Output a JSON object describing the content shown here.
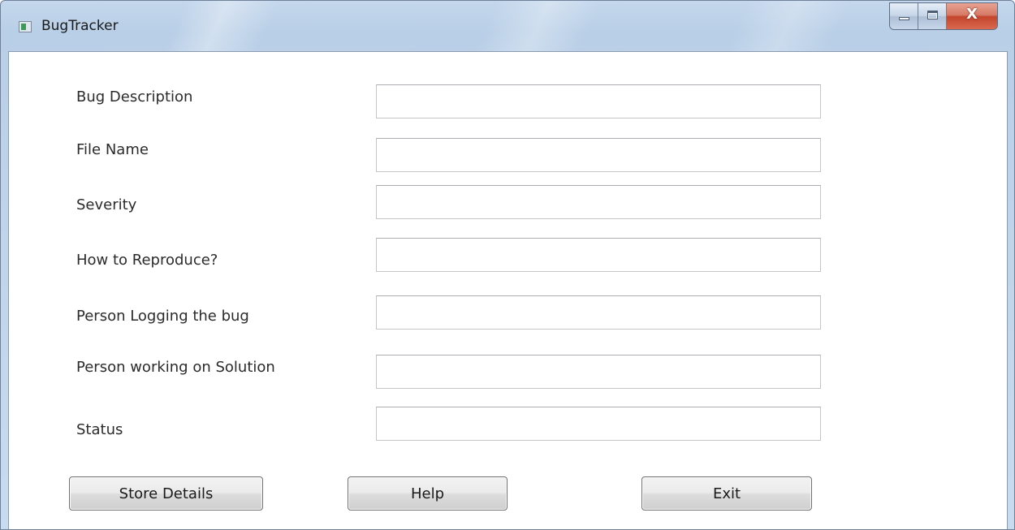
{
  "window": {
    "title": "BugTracker",
    "controls": {
      "minimize": "minimize-icon",
      "maximize": "maximize-icon",
      "close_label": "X"
    }
  },
  "form": {
    "fields": [
      {
        "label": "Bug Description",
        "value": ""
      },
      {
        "label": "File Name",
        "value": ""
      },
      {
        "label": "Severity",
        "value": ""
      },
      {
        "label": "How to Reproduce?",
        "value": ""
      },
      {
        "label": "Person Logging the bug",
        "value": ""
      },
      {
        "label": "Person working on Solution",
        "value": ""
      },
      {
        "label": "Status",
        "value": ""
      }
    ]
  },
  "buttons": {
    "store_label": "Store Details",
    "help_label": "Help",
    "exit_label": "Exit"
  },
  "colors": {
    "frame_blue": "#c4d7ec",
    "close_red": "#c3452c",
    "client_bg": "#ffffff"
  }
}
